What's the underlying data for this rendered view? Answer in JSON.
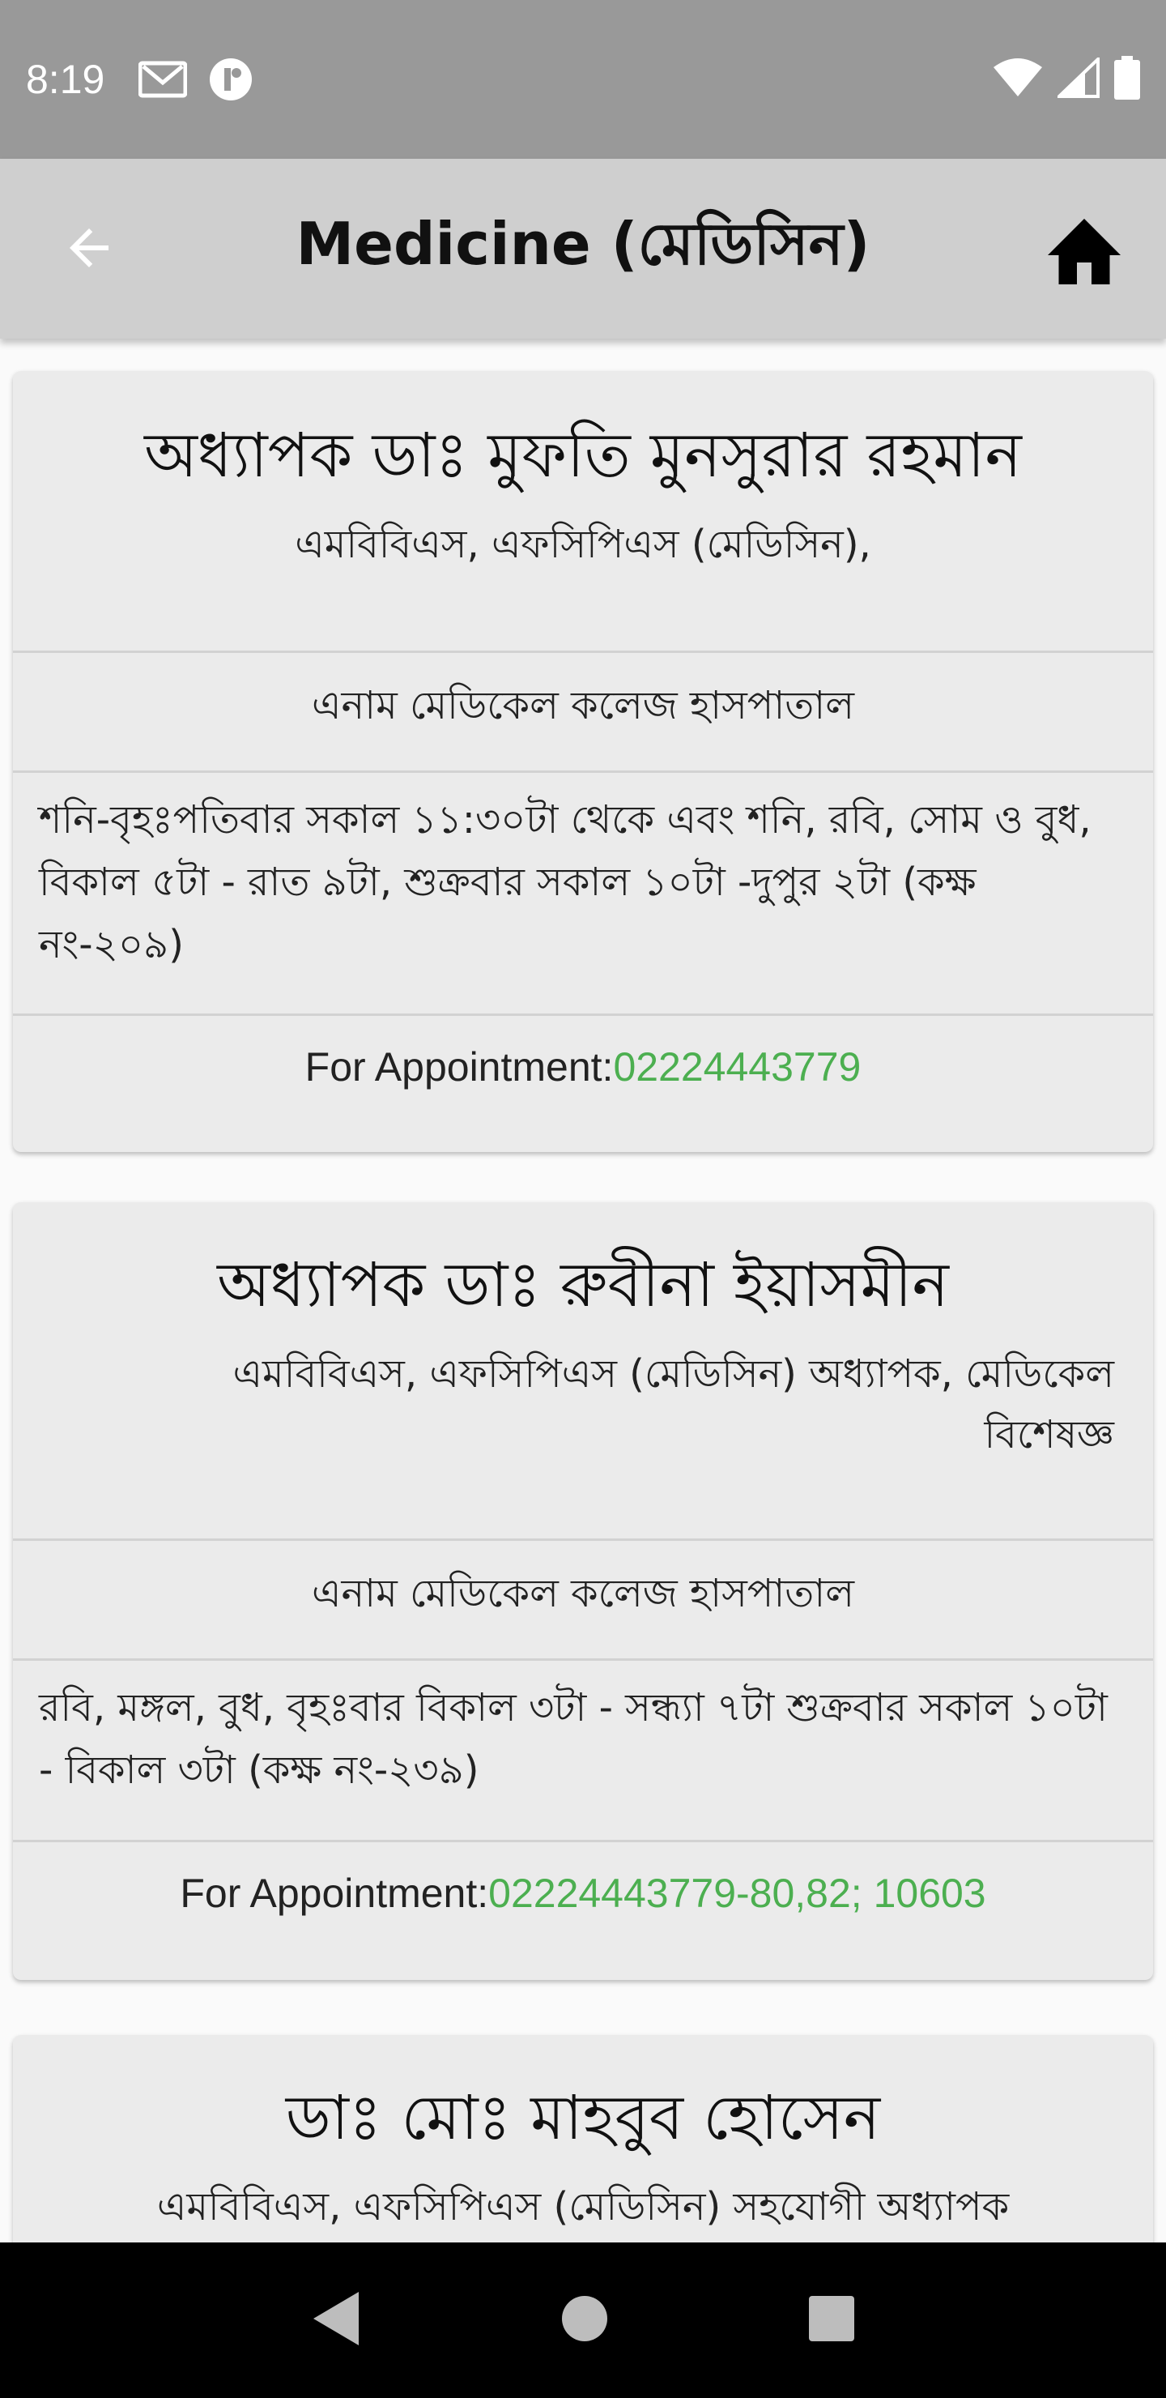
{
  "status_bar": {
    "time": "8:19",
    "icons": [
      "gmail-icon",
      "app-notification-icon",
      "wifi-icon",
      "signal-icon",
      "battery-icon"
    ]
  },
  "app_bar": {
    "title": "Medicine (মেডিসিন)",
    "back_icon": "arrow-back-icon",
    "home_icon": "home-icon"
  },
  "doctors": [
    {
      "name": "অধ্যাপক ডাঃ মুফতি মুনসুরার রহমান",
      "degree": "এমবিবিএস, এফসিপিএস (মেডিসিন),",
      "hospital": "এনাম মেডিকেল কলেজ হাসপাতাল",
      "schedule": "শনি-বৃহঃপতিবার সকাল ১১:৩০টা থেকে এবং শনি, রবি, সোম ও বুধ, বিকাল ৫টা - রাত ৯টা, শুক্রবার সকাল ১০টা -দুপুর ২টা (কক্ষ নং-২০৯)",
      "appointment_label": "For Appointment:",
      "phone": "02224443779"
    },
    {
      "name": "অধ্যাপক ডাঃ রুবীনা ইয়াসমীন",
      "degree": "এমবিবিএস, এফসিপিএস (মেডিসিন) অধ্যাপক, মেডিকেল বিশেষজ্ঞ",
      "hospital": "এনাম মেডিকেল কলেজ হাসপাতাল",
      "schedule": "রবি, মঙ্গল, বুধ, বৃহঃবার বিকাল ৩টা - সন্ধ্যা ৭টা শুক্রবার সকাল ১০টা - বিকাল ৩টা (কক্ষ নং-২৩৯)",
      "appointment_label": "For Appointment:",
      "phone": "02224443779-80,82; 10603"
    },
    {
      "name": "ডাঃ মোঃ মাহবুব হোসেন",
      "degree": "এমবিবিএস, এফসিপিএস (মেডিসিন) সহযোগী অধ্যাপক"
    }
  ],
  "colors": {
    "phone": "#4caf50",
    "app_bar": "#cfcfcf",
    "status_bar": "#999999",
    "card": "#ebebeb"
  },
  "nav_bar": {
    "icons": [
      "nav-back-icon",
      "nav-home-icon",
      "nav-recents-icon"
    ]
  }
}
